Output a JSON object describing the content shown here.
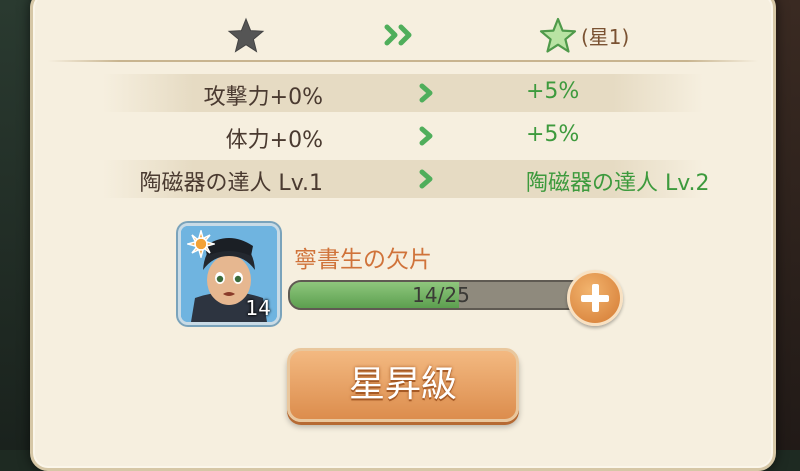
{
  "star_change": {
    "target_label": "(星1)"
  },
  "stats": [
    {
      "from": "攻撃力+0%",
      "to": "+5%"
    },
    {
      "from": "体力+0%",
      "to": "+5%"
    },
    {
      "from": "陶磁器の達人 Lv.1",
      "to": "陶磁器の達人 Lv.2"
    }
  ],
  "shard": {
    "name": "寧書生の欠片",
    "owned_count": "14",
    "progress_text": "14/25",
    "progress_fraction": 0.56
  },
  "actions": {
    "upgrade_label": "星昇級"
  },
  "colors": {
    "panel": "#f6efdf",
    "accent_green": "#3d9a3d",
    "button_orange": "#dc8d4d",
    "shard_name": "#d0733a"
  },
  "icons": {
    "current_star": "star-filled-gray",
    "next_star": "star-filled-green",
    "progression": "double-chevron-right",
    "shard_badge": "sun-emblem",
    "add": "plus"
  }
}
